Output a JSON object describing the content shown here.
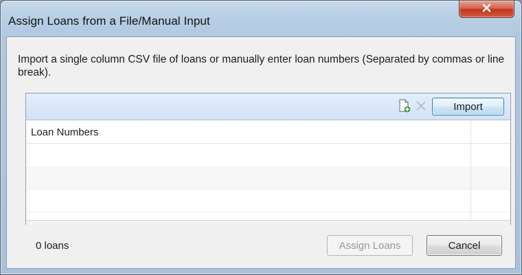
{
  "window": {
    "title": "Assign Loans from a File/Manual Input",
    "close_icon": "close-icon"
  },
  "instructions": "Import a single column CSV file of loans or manually enter loan numbers (Separated by commas or line break).",
  "toolbar": {
    "add_icon": "add-file-icon",
    "delete_icon": "delete-icon",
    "import_label": "Import"
  },
  "grid": {
    "column_header": "Loan Numbers",
    "rows": [
      "",
      "",
      ""
    ]
  },
  "footer": {
    "count_label": "0 loans",
    "assign_label": "Assign Loans",
    "cancel_label": "Cancel"
  },
  "colors": {
    "accent": "#3c7fb1",
    "close_red": "#c0381f",
    "disabled_text": "#9a9a9a"
  }
}
